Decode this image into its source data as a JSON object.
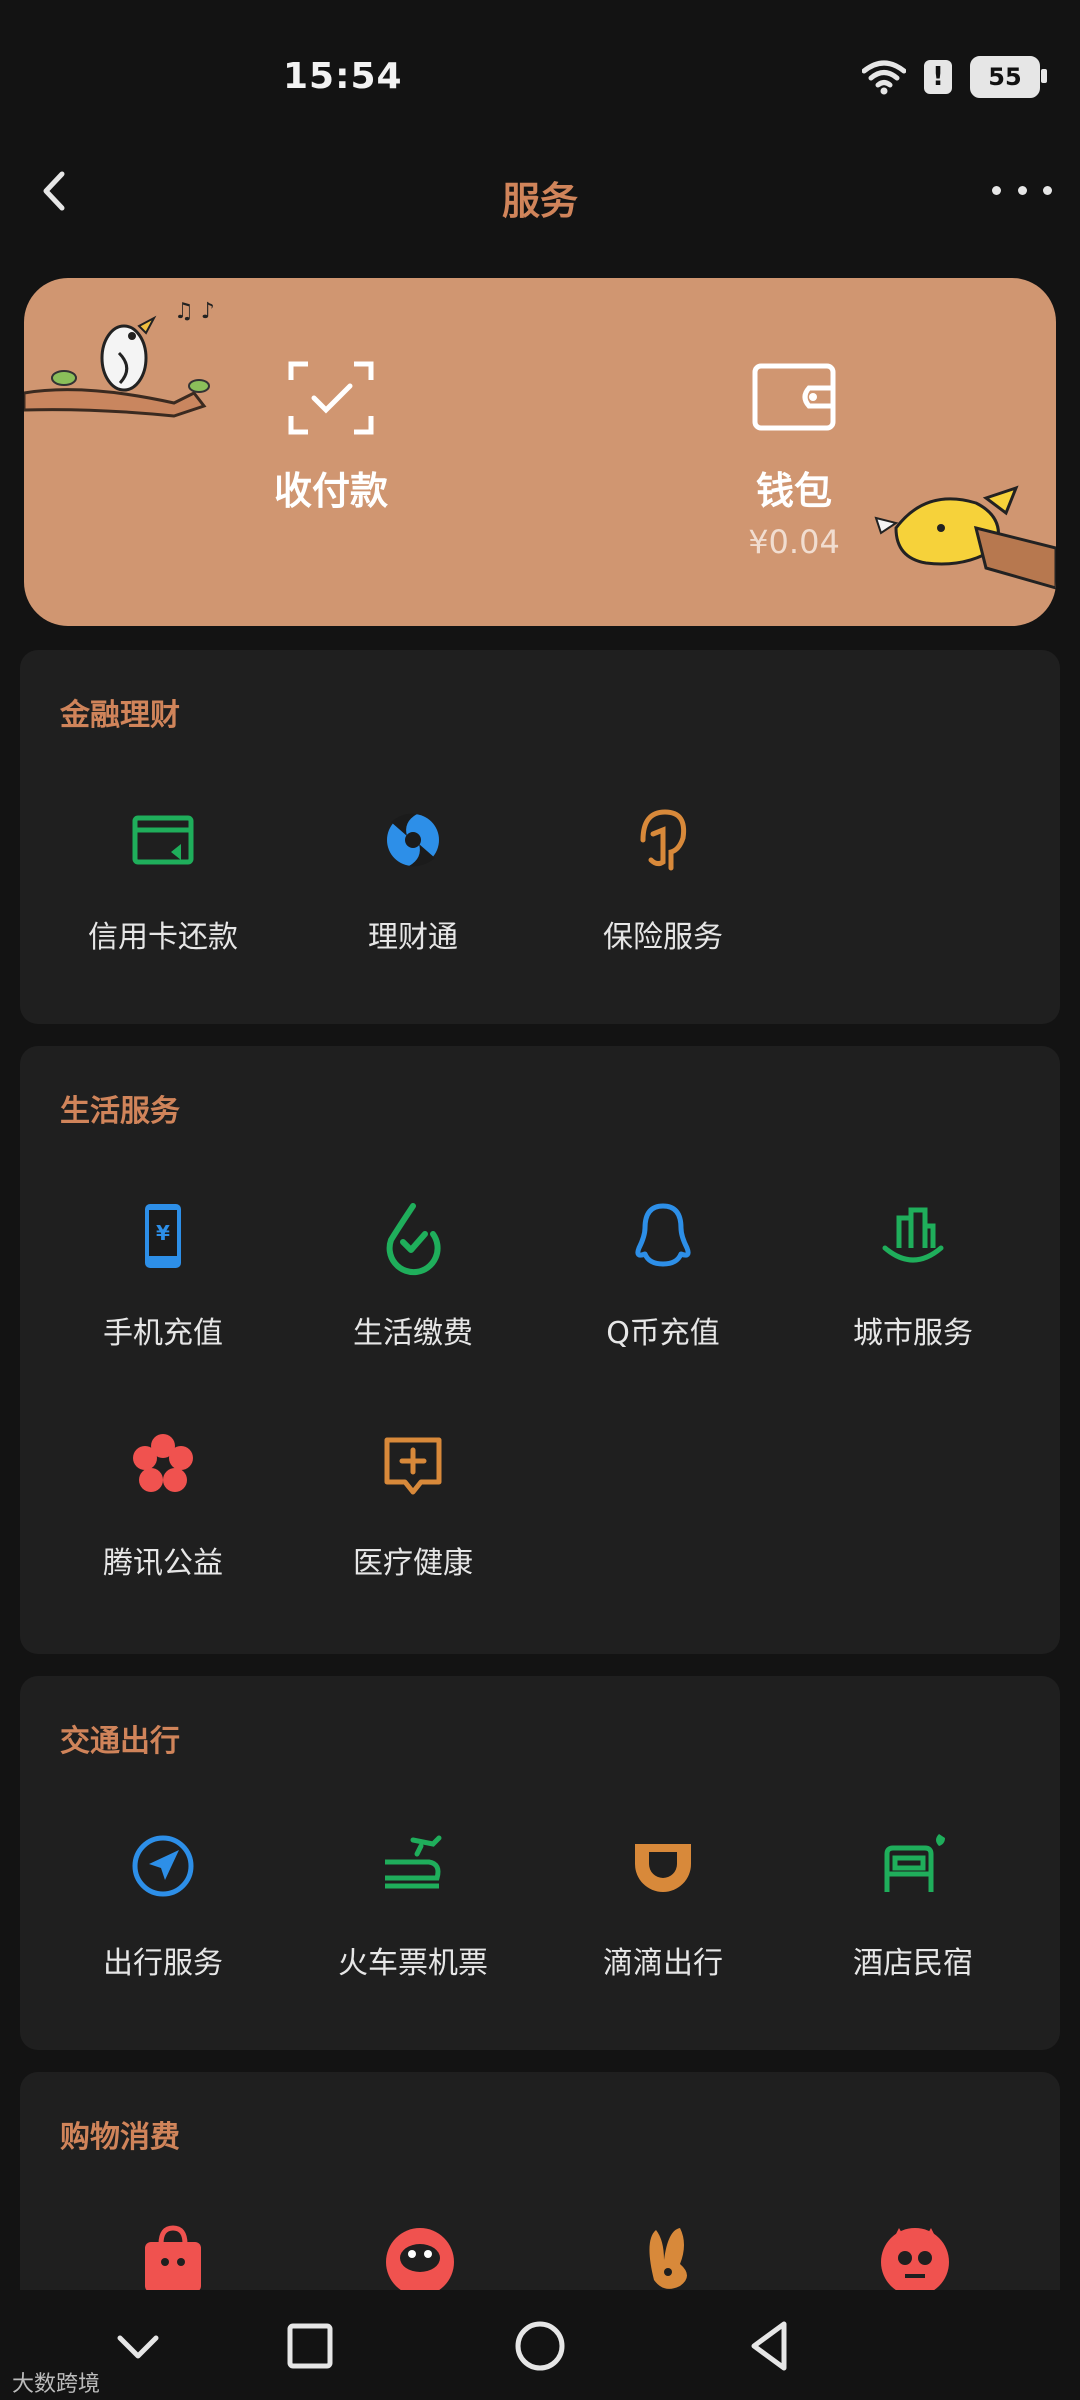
{
  "status": {
    "time": "15:54",
    "battery": "55"
  },
  "header": {
    "title": "服务"
  },
  "banner": {
    "pay_label": "收付款",
    "wallet_label": "钱包",
    "wallet_balance": "¥0.04"
  },
  "sections": {
    "finance": {
      "title": "金融理财",
      "items": [
        {
          "label": "信用卡还款",
          "icon": "credit-card-icon"
        },
        {
          "label": "理财通",
          "icon": "licaitong-icon"
        },
        {
          "label": "保险服务",
          "icon": "insurance-icon"
        }
      ]
    },
    "life": {
      "title": "生活服务",
      "items": [
        {
          "label": "手机充值",
          "icon": "phone-recharge-icon"
        },
        {
          "label": "生活缴费",
          "icon": "utility-payment-icon"
        },
        {
          "label": "Q币充值",
          "icon": "qq-coin-icon"
        },
        {
          "label": "城市服务",
          "icon": "city-service-icon"
        },
        {
          "label": "腾讯公益",
          "icon": "charity-flower-icon"
        },
        {
          "label": "医疗健康",
          "icon": "medical-icon"
        }
      ]
    },
    "travel": {
      "title": "交通出行",
      "items": [
        {
          "label": "出行服务",
          "icon": "navigation-icon"
        },
        {
          "label": "火车票机票",
          "icon": "train-plane-icon"
        },
        {
          "label": "滴滴出行",
          "icon": "didi-icon"
        },
        {
          "label": "酒店民宿",
          "icon": "hotel-bed-icon"
        }
      ]
    },
    "shopping": {
      "title": "购物消费"
    }
  },
  "watermark": "大数跨境",
  "colors": {
    "accent": "#d0845a",
    "banner": "#d09671",
    "card": "#1f1f1f",
    "background": "#131313"
  }
}
